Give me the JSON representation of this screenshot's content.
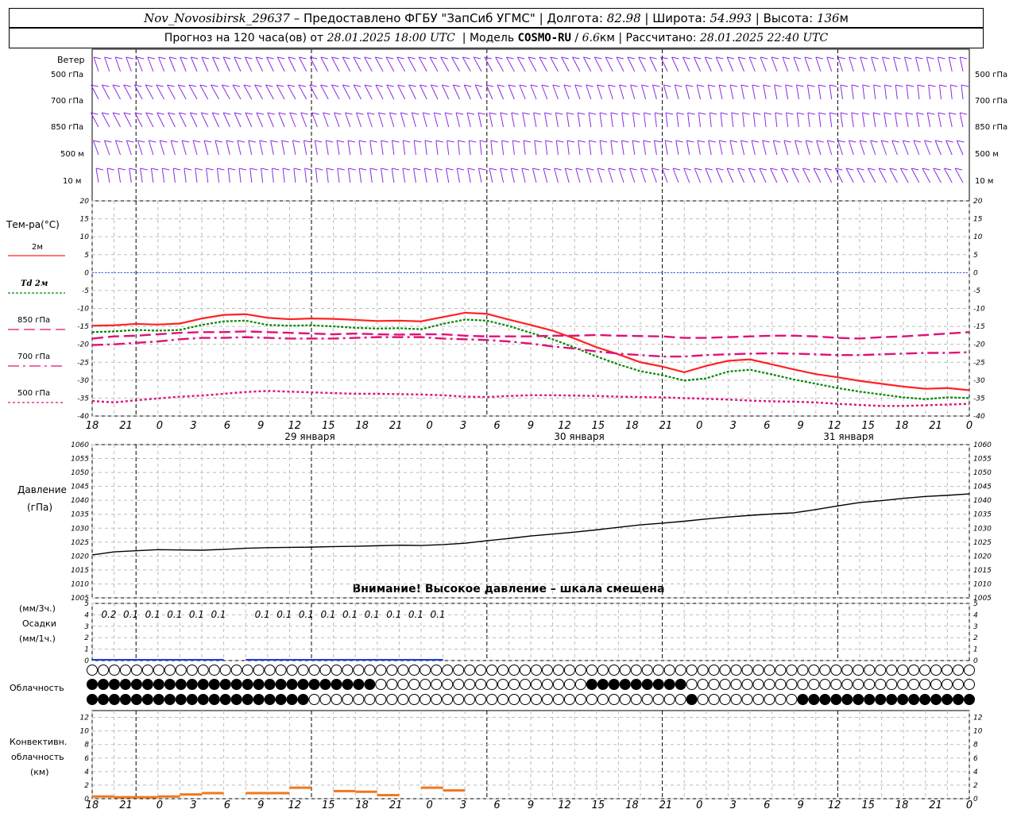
{
  "header": {
    "station": "Nov_Novosibirsk_29637",
    "provider": "– Предоставлено ФГБУ \"ЗапСиб УГМС\"",
    "lon_label": "Долгота:",
    "lon_value": "82.98",
    "lat_label": "Широта:",
    "lat_value": "54.993",
    "alt_label": "Высота:",
    "alt_value": "136",
    "alt_unit": "м",
    "forecast_label": "Прогноз на 120 часа(ов) от",
    "forecast_start": "28.01.2025 18:00 UTC",
    "model_label": "Модель",
    "model_name": "COSMO-RU",
    "model_res": "6.6",
    "model_res_unit": "км",
    "computed_label": "Рассчитано:",
    "computed_value": "28.01.2025 22:40 UTC"
  },
  "wind_panel": {
    "title": "Ветер",
    "levels": [
      "500 гПа",
      "700 гПа",
      "850 гПа",
      "500 м",
      "10 м"
    ],
    "colors": {
      "barb": "#8a2be2"
    }
  },
  "temp_panel": {
    "title": "Тем-ра(°C)",
    "legend": [
      {
        "label": "2м",
        "color": "#ff2222",
        "style": "solid"
      },
      {
        "label": "Td 2м",
        "color": "#008800",
        "style": "dotted"
      },
      {
        "label": "850 гПа",
        "color": "#e0107a",
        "style": "dash"
      },
      {
        "label": "700 гПа",
        "color": "#e0107a",
        "style": "dashdot"
      },
      {
        "label": "500 гПа",
        "color": "#e0107a",
        "style": "dot"
      }
    ],
    "y_ticks": [
      "20",
      "15",
      "10",
      "5",
      "0",
      "-5",
      "-10",
      "-15",
      "-20",
      "-25",
      "-30",
      "-35",
      "-40"
    ]
  },
  "time_axis": {
    "hour_labels": [
      "18",
      "21",
      "0",
      "3",
      "6",
      "9",
      "12",
      "15",
      "18",
      "21",
      "0",
      "3",
      "6",
      "9",
      "12",
      "15",
      "18",
      "21",
      "0",
      "3",
      "6",
      "9",
      "12",
      "15",
      "18",
      "21",
      "0"
    ],
    "day_labels": [
      "29 января",
      "30 января",
      "31 января"
    ]
  },
  "pressure_panel": {
    "title": "Давление",
    "unit": "(гПа)",
    "warning": "Внимание! Высокое давление – шкала смещена",
    "y_ticks": [
      "1060",
      "1055",
      "1050",
      "1045",
      "1040",
      "1035",
      "1030",
      "1025",
      "1020",
      "1015",
      "1010",
      "1005"
    ]
  },
  "precip_panel": {
    "label1": "(мм/3ч.)",
    "label2": "Осадки",
    "label3": "(мм/1ч.)",
    "y_ticks": [
      "5",
      "4",
      "3",
      "2",
      "1",
      "0"
    ],
    "amount_labels": [
      "0.2",
      "0.1",
      "0.1",
      "0.1",
      "0.1",
      "0.1",
      "",
      "0.1",
      "0.1",
      "0.1",
      "0.1",
      "0.1",
      "0.1",
      "0.1",
      "0.1",
      "0.1"
    ],
    "colors": {
      "bar": "#1a3fd6"
    }
  },
  "cloud_panel": {
    "title": "Облачность"
  },
  "conv_panel": {
    "label1": "Конвективн.",
    "label2": "облачность",
    "label3": "(км)",
    "y_ticks": [
      "12",
      "10",
      "8",
      "6",
      "4",
      "2",
      "0"
    ],
    "colors": {
      "bar": "#f07820"
    }
  },
  "chart_data": [
    {
      "type": "line",
      "title": "Тем-ра(°C)",
      "x": [
        -6,
        -3,
        0,
        3,
        6,
        9,
        12,
        15,
        18,
        21,
        24,
        27,
        30,
        33,
        36,
        39,
        42,
        45,
        48,
        51,
        54,
        57,
        60,
        63,
        66,
        69,
        72,
        75,
        78,
        81,
        84,
        87,
        90,
        93,
        96,
        99,
        102,
        105,
        108,
        111,
        114
      ],
      "x_note": "часы от 29.01.2025 00 UTC",
      "ylim": [
        -40,
        20
      ],
      "series": [
        {
          "name": "2м",
          "values": [
            -14.8,
            -14.7,
            -14.3,
            -14.5,
            -14.2,
            -12.8,
            -11.8,
            -11.6,
            -12.6,
            -13.0,
            -12.8,
            -12.9,
            -13.2,
            -13.5,
            -13.4,
            -13.6,
            -12.4,
            -11.2,
            -11.5,
            -13.1,
            -14.6,
            -16.2,
            -18.4,
            -20.8,
            -22.8,
            -25.0,
            -26.2,
            -27.8,
            -26.0,
            -24.6,
            -24.2,
            -25.6,
            -27.0,
            -28.3,
            -29.2,
            -30.2,
            -31.0,
            -31.8,
            -32.4,
            -32.2,
            -32.8
          ]
        },
        {
          "name": "Td 2м",
          "values": [
            -16.6,
            -16.4,
            -16.0,
            -16.2,
            -16.0,
            -14.6,
            -13.6,
            -13.4,
            -14.6,
            -14.8,
            -14.7,
            -15.0,
            -15.4,
            -15.6,
            -15.5,
            -15.8,
            -14.3,
            -13.1,
            -13.4,
            -14.9,
            -16.8,
            -18.6,
            -20.9,
            -23.4,
            -25.6,
            -27.5,
            -28.6,
            -30.1,
            -29.5,
            -27.6,
            -27.1,
            -28.4,
            -29.8,
            -31.0,
            -32.2,
            -33.2,
            -34.0,
            -34.8,
            -35.3,
            -34.8,
            -35.0
          ]
        },
        {
          "name": "850 гПа",
          "values": [
            -18.4,
            -17.8,
            -17.6,
            -17.2,
            -16.8,
            -16.6,
            -16.6,
            -16.4,
            -16.6,
            -16.8,
            -17.0,
            -17.2,
            -17.0,
            -17.2,
            -17.3,
            -17.2,
            -17.2,
            -17.6,
            -17.8,
            -17.8,
            -17.8,
            -17.6,
            -17.6,
            -17.4,
            -17.6,
            -17.7,
            -17.8,
            -18.2,
            -18.2,
            -18.0,
            -17.8,
            -17.6,
            -17.6,
            -17.8,
            -18.2,
            -18.4,
            -18.0,
            -17.8,
            -17.4,
            -17.0,
            -16.6
          ]
        },
        {
          "name": "700 гПа",
          "values": [
            -20.2,
            -20.0,
            -19.6,
            -19.2,
            -18.6,
            -18.2,
            -18.2,
            -18.0,
            -18.2,
            -18.4,
            -18.4,
            -18.4,
            -18.2,
            -18.0,
            -18.0,
            -18.0,
            -18.4,
            -18.6,
            -18.8,
            -19.2,
            -19.8,
            -20.6,
            -21.2,
            -22.0,
            -22.6,
            -23.0,
            -23.4,
            -23.4,
            -23.0,
            -22.8,
            -22.6,
            -22.5,
            -22.6,
            -22.8,
            -23.0,
            -23.0,
            -22.8,
            -22.6,
            -22.4,
            -22.4,
            -22.2
          ]
        },
        {
          "name": "500 гПа",
          "values": [
            -35.8,
            -36.2,
            -35.6,
            -35.1,
            -34.6,
            -34.3,
            -33.8,
            -33.3,
            -33.0,
            -33.2,
            -33.4,
            -33.6,
            -33.8,
            -33.8,
            -33.9,
            -34.0,
            -34.2,
            -34.6,
            -34.7,
            -34.4,
            -34.2,
            -34.2,
            -34.3,
            -34.4,
            -34.6,
            -34.7,
            -34.8,
            -35.0,
            -35.2,
            -35.4,
            -35.7,
            -35.9,
            -36.0,
            -36.2,
            -36.6,
            -36.9,
            -37.2,
            -37.2,
            -37.0,
            -36.8,
            -36.6
          ]
        }
      ]
    },
    {
      "type": "line",
      "title": "Давление",
      "x": [
        -6,
        -3,
        0,
        3,
        6,
        9,
        12,
        15,
        18,
        21,
        24,
        27,
        30,
        33,
        36,
        39,
        42,
        45,
        48,
        51,
        54,
        57,
        60,
        63,
        66,
        69,
        72,
        75,
        78,
        81,
        84,
        87,
        90,
        93,
        96,
        99,
        102,
        105,
        108,
        111,
        114
      ],
      "ylim": [
        1005,
        1060
      ],
      "series": [
        {
          "name": "",
          "values": [
            1020.4,
            1021.5,
            1021.9,
            1022.3,
            1022.2,
            1022.1,
            1022.4,
            1022.8,
            1023.0,
            1023.1,
            1023.2,
            1023.4,
            1023.5,
            1023.7,
            1023.9,
            1023.8,
            1024.1,
            1024.6,
            1025.5,
            1026.3,
            1027.2,
            1027.9,
            1028.6,
            1029.4,
            1030.3,
            1031.2,
            1031.8,
            1032.5,
            1033.3,
            1034.0,
            1034.6,
            1035.1,
            1035.5,
            1036.7,
            1038.0,
            1039.2,
            1039.9,
            1040.7,
            1041.4,
            1041.8,
            1042.3
          ]
        }
      ]
    },
    {
      "type": "bar",
      "title": "Осадки",
      "categories_note": "3-часовые интервалы",
      "x": [
        -6,
        -3,
        0,
        3,
        6,
        9,
        12,
        15,
        18,
        21,
        24,
        27,
        30,
        33,
        36,
        39,
        42,
        45,
        48,
        51,
        54,
        57,
        60,
        63,
        66,
        69,
        72,
        75,
        78,
        81,
        84,
        87,
        90,
        93,
        96,
        99,
        102,
        105,
        108,
        111,
        114
      ],
      "values": [
        0.2,
        0.1,
        0.1,
        0.1,
        0.1,
        0.1,
        0.0,
        0.1,
        0.1,
        0.1,
        0.1,
        0.1,
        0.1,
        0.1,
        0.1,
        0.1,
        0,
        0,
        0,
        0,
        0,
        0,
        0,
        0,
        0,
        0,
        0,
        0,
        0,
        0,
        0,
        0,
        0,
        0,
        0,
        0,
        0,
        0,
        0,
        0,
        0
      ],
      "ylim": [
        0,
        5
      ]
    },
    {
      "type": "bar",
      "title": "Конвективн. облачность (км)",
      "x": [
        -6,
        -3,
        0,
        3,
        6,
        9,
        12,
        15,
        18,
        21,
        24,
        27,
        30,
        33,
        36,
        39,
        42,
        45,
        48,
        51,
        54,
        57,
        60,
        63,
        66,
        69,
        72,
        75,
        78,
        81,
        84,
        87,
        90,
        93,
        96,
        99,
        102,
        105,
        108,
        111,
        114
      ],
      "values": [
        0.5,
        0.4,
        0.4,
        0.5,
        0.8,
        1.0,
        0,
        1.0,
        1.0,
        1.8,
        0,
        1.3,
        1.2,
        0.7,
        0,
        1.8,
        1.4,
        0,
        0,
        0,
        0,
        0,
        0,
        0,
        0,
        0,
        0,
        0,
        0,
        0,
        0,
        0,
        0,
        0,
        0,
        0,
        0,
        0,
        0,
        0,
        0
      ],
      "ylim": [
        0,
        13
      ]
    }
  ]
}
